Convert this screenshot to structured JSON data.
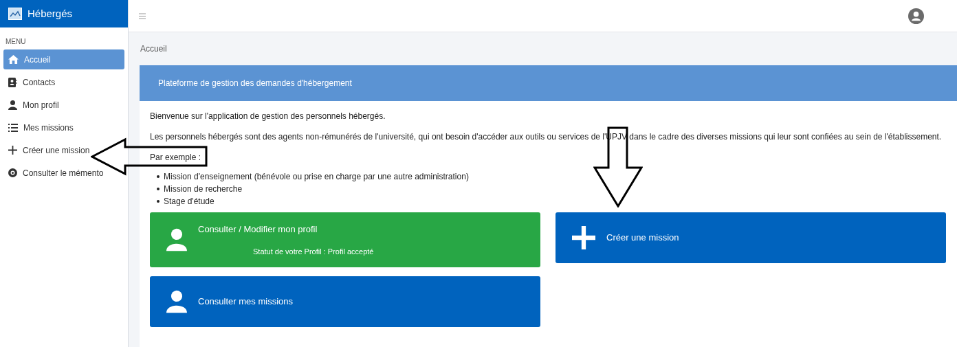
{
  "app": {
    "title": "Hébergés"
  },
  "sidebar": {
    "heading": "MENU",
    "items": [
      {
        "label": "Accueil",
        "kind": "home",
        "selected": true
      },
      {
        "label": "Contacts",
        "kind": "contact",
        "selected": false
      },
      {
        "label": "Mon profil",
        "kind": "person",
        "selected": false
      },
      {
        "label": "Mes missions",
        "kind": "list",
        "selected": false
      },
      {
        "label": "Créer une mission",
        "kind": "plus",
        "selected": false
      },
      {
        "label": "Consulter le mémento",
        "kind": "eye",
        "selected": false
      }
    ]
  },
  "breadcrumb": "Accueil",
  "card": {
    "title": "Plateforme de gestion des demandes d'hébergement",
    "paragraphs": [
      "Bienvenue sur l'application de gestion des personnels hébergés.",
      "Les personnels hébergés sont des agents non-rémunérés de l'université, qui ont besoin d'accéder aux outils ou services de l'UPJV dans le cadre des diverses missions qui leur sont confiées au sein de l'établissement."
    ],
    "examples_label": "Par exemple :",
    "examples": [
      "Mission d'enseignement (bénévole ou prise en charge par une autre administration)",
      "Mission de recherche",
      "Stage d'étude"
    ]
  },
  "tiles": [
    {
      "title": "Consulter / Modifier mon profil",
      "status": "Statut de votre Profil : Profil accepté",
      "kind": "person",
      "color": "#28a745"
    },
    {
      "title": "Créer une mission",
      "kind": "plus",
      "color": "#0063be"
    },
    {
      "title": "Consulter mes missions",
      "kind": "person",
      "color": "#0063be"
    }
  ]
}
